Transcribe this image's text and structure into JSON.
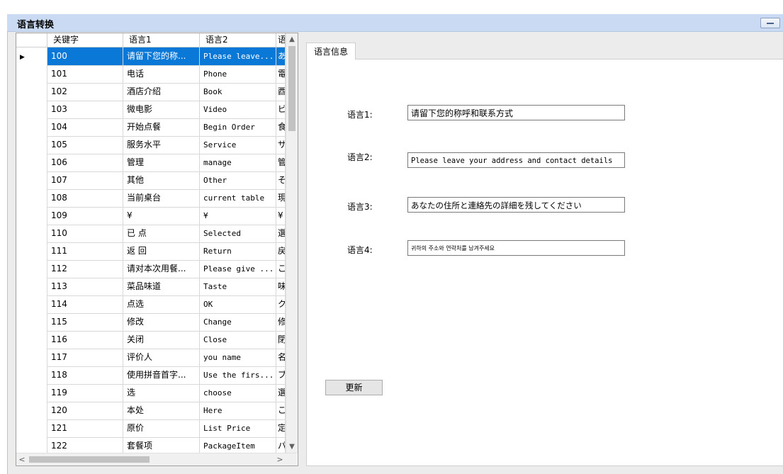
{
  "window": {
    "title": "语言转换"
  },
  "grid": {
    "columns": [
      "关键字",
      "语言1",
      "语言2",
      "语"
    ],
    "rows": [
      [
        "100",
        "请留下您的称...",
        "Please leave...",
        "あ"
      ],
      [
        "101",
        "电话",
        "Phone",
        "電"
      ],
      [
        "102",
        "酒店介绍",
        "Book",
        "酉"
      ],
      [
        "103",
        "微电影",
        "Video",
        "ビ"
      ],
      [
        "104",
        "开始点餐",
        "Begin Order",
        "食"
      ],
      [
        "105",
        "服务水平",
        "Service",
        "サ"
      ],
      [
        "106",
        "管理",
        "manage",
        "管"
      ],
      [
        "107",
        "其他",
        "Other",
        "そ"
      ],
      [
        "108",
        "当前桌台",
        "current table",
        "現"
      ],
      [
        "109",
        "¥",
        "¥",
        "¥"
      ],
      [
        "110",
        "已 点",
        "Selected",
        "選"
      ],
      [
        "111",
        "返 回",
        "Return",
        "戻"
      ],
      [
        "112",
        "请对本次用餐...",
        "Please give ...",
        "こ"
      ],
      [
        "113",
        "菜品味道",
        "Taste",
        "味"
      ],
      [
        "114",
        "点选",
        "OK",
        "ク"
      ],
      [
        "115",
        "修改",
        "Change",
        "修"
      ],
      [
        "116",
        "关闭",
        "Close",
        "閉"
      ],
      [
        "117",
        "评价人",
        "you name",
        "名"
      ],
      [
        "118",
        "使用拼音首字...",
        "Use the firs...",
        "ブ"
      ],
      [
        "119",
        "选",
        "choose",
        "選"
      ],
      [
        "120",
        "本处",
        "Here",
        "こ"
      ],
      [
        "121",
        "原价",
        "List Price",
        "定"
      ],
      [
        "122",
        "套餐项",
        "PackageItem",
        "パ"
      ]
    ],
    "selected_row": 0,
    "selected_marker": "▶",
    "scroll_up": "▲",
    "scroll_down": "▼",
    "scroll_left": "<",
    "scroll_right": ">"
  },
  "panel": {
    "tab_label": "语言信息",
    "fields": [
      {
        "label": "语言1:",
        "value": "请留下您的称呼和联系方式"
      },
      {
        "label": "语言2:",
        "value": "Please leave your address and contact details"
      },
      {
        "label": "语言3:",
        "value": "あなたの住所と連絡先の詳細を残してください"
      },
      {
        "label": "语言4:",
        "value": "귀하의 주소와 연락처를 남겨주세요"
      }
    ],
    "update_button": "更新"
  }
}
